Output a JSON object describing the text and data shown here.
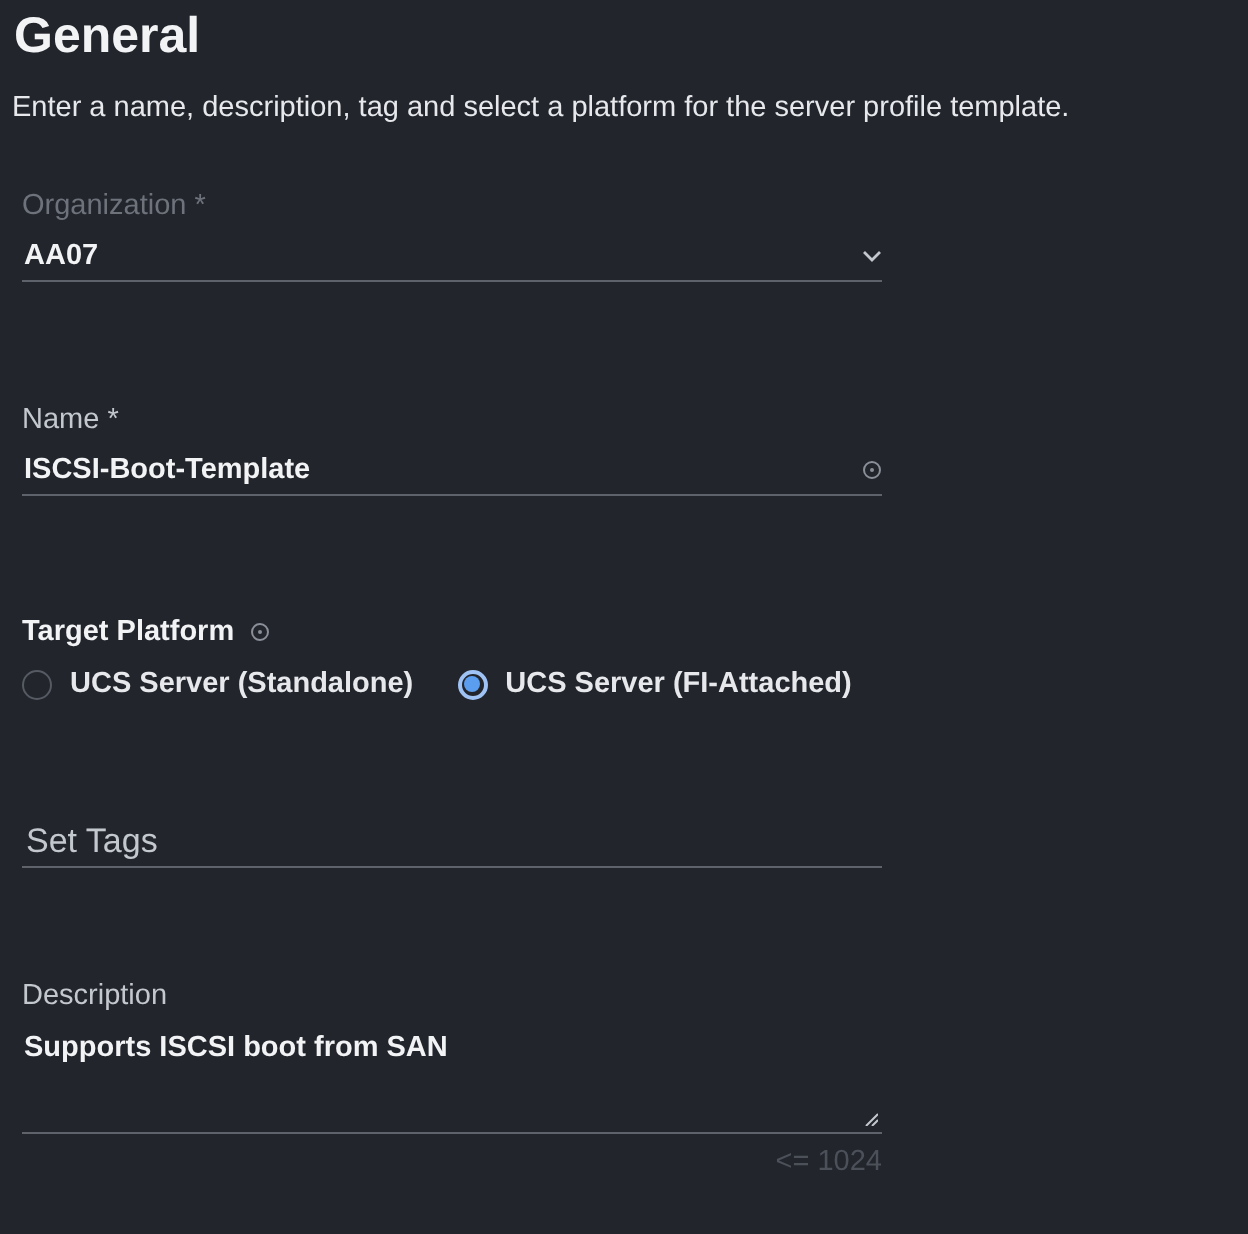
{
  "title": "General",
  "subtitle": "Enter a name, description, tag and select a platform for the server profile template.",
  "organization": {
    "label": "Organization *",
    "value": "AA07"
  },
  "name": {
    "label": "Name *",
    "value": "ISCSI-Boot-Template"
  },
  "target_platform": {
    "label": "Target Platform",
    "options": [
      {
        "label": "UCS Server (Standalone)",
        "selected": false
      },
      {
        "label": "UCS Server (FI-Attached)",
        "selected": true
      }
    ]
  },
  "tags": {
    "placeholder": "Set Tags"
  },
  "description": {
    "label": "Description",
    "value": "Supports ISCSI boot from SAN",
    "counter": "<= 1024"
  }
}
